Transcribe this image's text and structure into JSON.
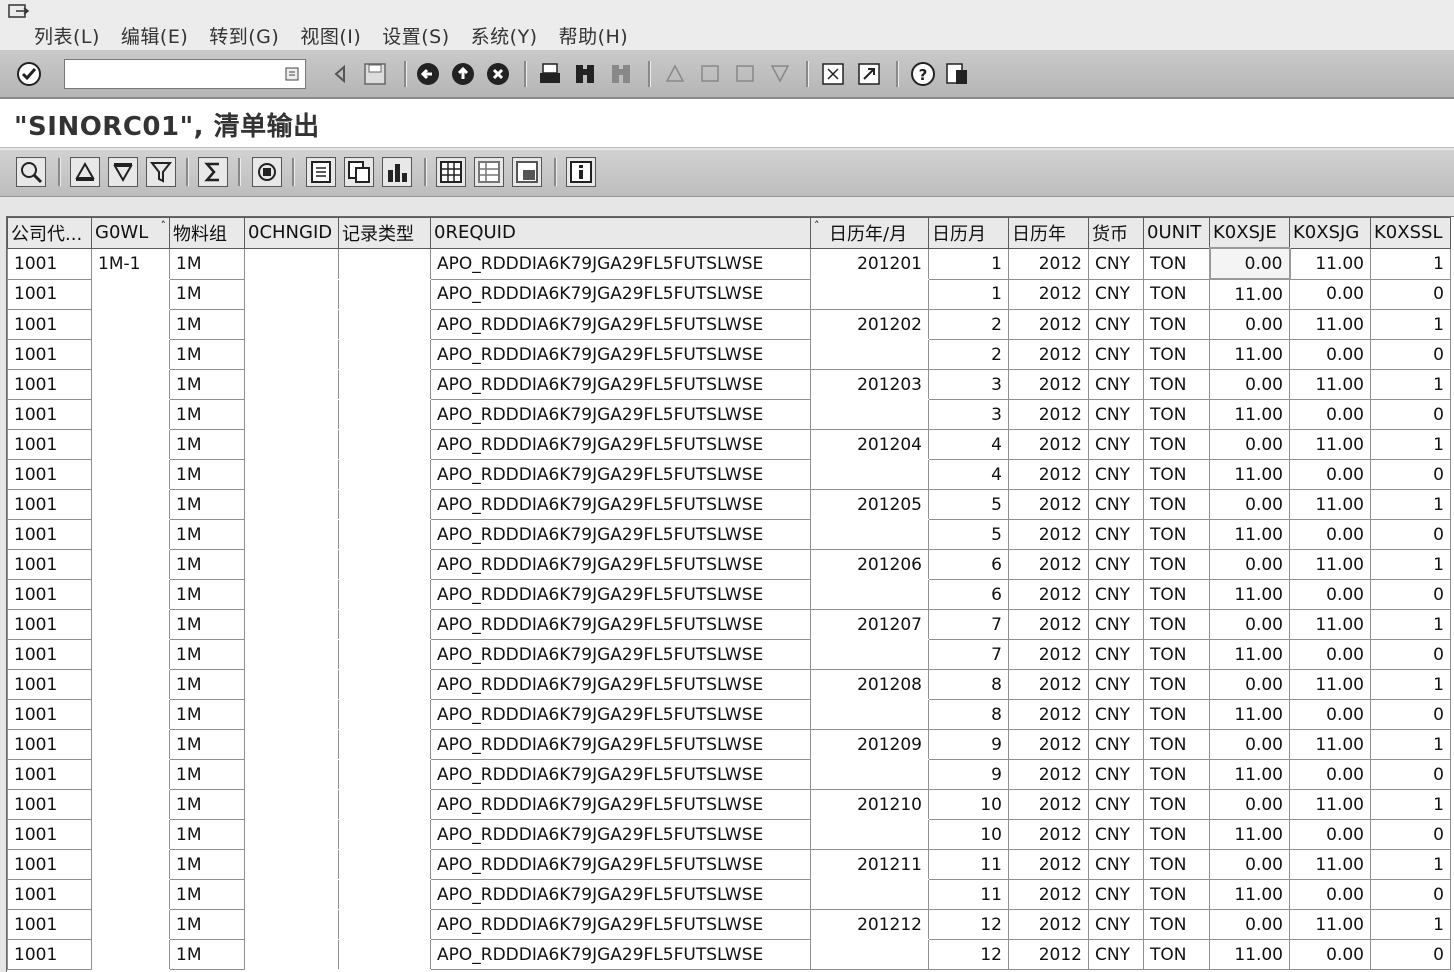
{
  "menu": {
    "items": [
      "列表(L)",
      "编辑(E)",
      "转到(G)",
      "视图(I)",
      "设置(S)",
      "系统(Y)",
      "帮助(H)"
    ]
  },
  "toolbar": {
    "command_value": ""
  },
  "title": "\"SINORC01\", 清单输出",
  "columns": [
    "公司代...",
    "G0WL",
    "物料组",
    "0CHNGID",
    "记录类型",
    "0REQUID",
    "日历年/月",
    "日历月",
    "日历年",
    "货币",
    "0UNIT",
    "K0XSJE",
    "K0XSJG",
    "K0XSSL"
  ],
  "rows": [
    [
      "1001",
      "1M-1",
      "1M",
      "",
      "",
      "APO_RDDDIA6K79JGA29FL5FUTSLWSE",
      "201201",
      "1",
      "2012",
      "CNY",
      "TON",
      "0.00",
      "11.00",
      "1"
    ],
    [
      "1001",
      "",
      "1M",
      "",
      "",
      "APO_RDDDIA6K79JGA29FL5FUTSLWSE",
      "",
      "1",
      "2012",
      "CNY",
      "TON",
      "11.00",
      "0.00",
      "0"
    ],
    [
      "1001",
      "",
      "1M",
      "",
      "",
      "APO_RDDDIA6K79JGA29FL5FUTSLWSE",
      "201202",
      "2",
      "2012",
      "CNY",
      "TON",
      "0.00",
      "11.00",
      "1"
    ],
    [
      "1001",
      "",
      "1M",
      "",
      "",
      "APO_RDDDIA6K79JGA29FL5FUTSLWSE",
      "",
      "2",
      "2012",
      "CNY",
      "TON",
      "11.00",
      "0.00",
      "0"
    ],
    [
      "1001",
      "",
      "1M",
      "",
      "",
      "APO_RDDDIA6K79JGA29FL5FUTSLWSE",
      "201203",
      "3",
      "2012",
      "CNY",
      "TON",
      "0.00",
      "11.00",
      "1"
    ],
    [
      "1001",
      "",
      "1M",
      "",
      "",
      "APO_RDDDIA6K79JGA29FL5FUTSLWSE",
      "",
      "3",
      "2012",
      "CNY",
      "TON",
      "11.00",
      "0.00",
      "0"
    ],
    [
      "1001",
      "",
      "1M",
      "",
      "",
      "APO_RDDDIA6K79JGA29FL5FUTSLWSE",
      "201204",
      "4",
      "2012",
      "CNY",
      "TON",
      "0.00",
      "11.00",
      "1"
    ],
    [
      "1001",
      "",
      "1M",
      "",
      "",
      "APO_RDDDIA6K79JGA29FL5FUTSLWSE",
      "",
      "4",
      "2012",
      "CNY",
      "TON",
      "11.00",
      "0.00",
      "0"
    ],
    [
      "1001",
      "",
      "1M",
      "",
      "",
      "APO_RDDDIA6K79JGA29FL5FUTSLWSE",
      "201205",
      "5",
      "2012",
      "CNY",
      "TON",
      "0.00",
      "11.00",
      "1"
    ],
    [
      "1001",
      "",
      "1M",
      "",
      "",
      "APO_RDDDIA6K79JGA29FL5FUTSLWSE",
      "",
      "5",
      "2012",
      "CNY",
      "TON",
      "11.00",
      "0.00",
      "0"
    ],
    [
      "1001",
      "",
      "1M",
      "",
      "",
      "APO_RDDDIA6K79JGA29FL5FUTSLWSE",
      "201206",
      "6",
      "2012",
      "CNY",
      "TON",
      "0.00",
      "11.00",
      "1"
    ],
    [
      "1001",
      "",
      "1M",
      "",
      "",
      "APO_RDDDIA6K79JGA29FL5FUTSLWSE",
      "",
      "6",
      "2012",
      "CNY",
      "TON",
      "11.00",
      "0.00",
      "0"
    ],
    [
      "1001",
      "",
      "1M",
      "",
      "",
      "APO_RDDDIA6K79JGA29FL5FUTSLWSE",
      "201207",
      "7",
      "2012",
      "CNY",
      "TON",
      "0.00",
      "11.00",
      "1"
    ],
    [
      "1001",
      "",
      "1M",
      "",
      "",
      "APO_RDDDIA6K79JGA29FL5FUTSLWSE",
      "",
      "7",
      "2012",
      "CNY",
      "TON",
      "11.00",
      "0.00",
      "0"
    ],
    [
      "1001",
      "",
      "1M",
      "",
      "",
      "APO_RDDDIA6K79JGA29FL5FUTSLWSE",
      "201208",
      "8",
      "2012",
      "CNY",
      "TON",
      "0.00",
      "11.00",
      "1"
    ],
    [
      "1001",
      "",
      "1M",
      "",
      "",
      "APO_RDDDIA6K79JGA29FL5FUTSLWSE",
      "",
      "8",
      "2012",
      "CNY",
      "TON",
      "11.00",
      "0.00",
      "0"
    ],
    [
      "1001",
      "",
      "1M",
      "",
      "",
      "APO_RDDDIA6K79JGA29FL5FUTSLWSE",
      "201209",
      "9",
      "2012",
      "CNY",
      "TON",
      "0.00",
      "11.00",
      "1"
    ],
    [
      "1001",
      "",
      "1M",
      "",
      "",
      "APO_RDDDIA6K79JGA29FL5FUTSLWSE",
      "",
      "9",
      "2012",
      "CNY",
      "TON",
      "11.00",
      "0.00",
      "0"
    ],
    [
      "1001",
      "",
      "1M",
      "",
      "",
      "APO_RDDDIA6K79JGA29FL5FUTSLWSE",
      "201210",
      "10",
      "2012",
      "CNY",
      "TON",
      "0.00",
      "11.00",
      "1"
    ],
    [
      "1001",
      "",
      "1M",
      "",
      "",
      "APO_RDDDIA6K79JGA29FL5FUTSLWSE",
      "",
      "10",
      "2012",
      "CNY",
      "TON",
      "11.00",
      "0.00",
      "0"
    ],
    [
      "1001",
      "",
      "1M",
      "",
      "",
      "APO_RDDDIA6K79JGA29FL5FUTSLWSE",
      "201211",
      "11",
      "2012",
      "CNY",
      "TON",
      "0.00",
      "11.00",
      "1"
    ],
    [
      "1001",
      "",
      "1M",
      "",
      "",
      "APO_RDDDIA6K79JGA29FL5FUTSLWSE",
      "",
      "11",
      "2012",
      "CNY",
      "TON",
      "11.00",
      "0.00",
      "0"
    ],
    [
      "1001",
      "",
      "1M",
      "",
      "",
      "APO_RDDDIA6K79JGA29FL5FUTSLWSE",
      "201212",
      "12",
      "2012",
      "CNY",
      "TON",
      "0.00",
      "11.00",
      "1"
    ],
    [
      "1001",
      "",
      "1M",
      "",
      "",
      "APO_RDDDIA6K79JGA29FL5FUTSLWSE",
      "",
      "12",
      "2012",
      "CNY",
      "TON",
      "11.00",
      "0.00",
      "0"
    ]
  ]
}
